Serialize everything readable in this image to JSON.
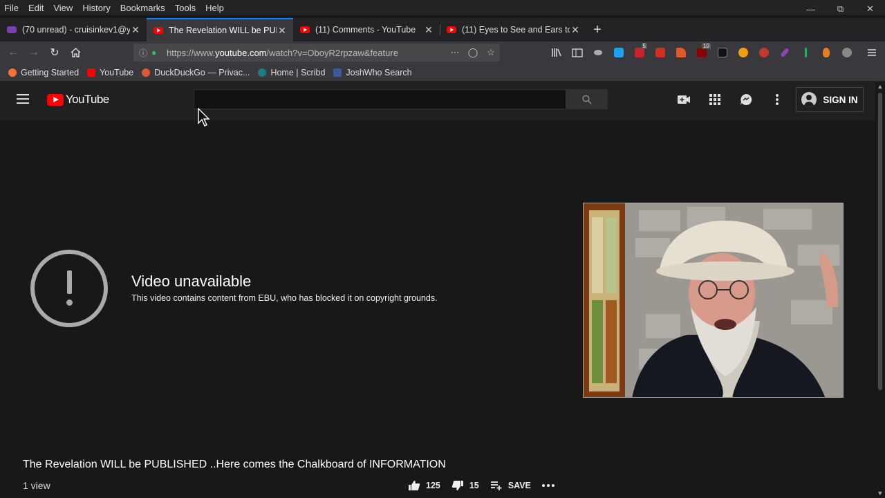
{
  "menubar": {
    "items": [
      "File",
      "Edit",
      "View",
      "History",
      "Bookmarks",
      "Tools",
      "Help"
    ]
  },
  "tabs": [
    {
      "title": "(70 unread) - cruisinkev1@y",
      "active": false
    },
    {
      "title": "The Revelation WILL be PUB",
      "active": true
    },
    {
      "title": "(11) Comments - YouTube",
      "active": false
    },
    {
      "title": "(11) Eyes to See and Ears to",
      "active": false
    }
  ],
  "url": {
    "prefix": "https://www.",
    "domain": "youtube.com",
    "path": "/watch?v=OboyR2rpzaw&feature"
  },
  "bookmarks": [
    "Getting Started",
    "YouTube",
    "DuckDuckGo — Privac...",
    "Home | Scribd",
    "JoshWho Search"
  ],
  "extensions": {
    "abp_badge": "5",
    "ublock_badge": "10"
  },
  "youtube": {
    "logo_text": "YouTube",
    "search_placeholder": "",
    "sign_in": "SIGN IN"
  },
  "player": {
    "error_title": "Video unavailable",
    "error_message": "This video contains content from EBU, who has blocked it on copyright grounds."
  },
  "video": {
    "title": "The Revelation WILL be PUBLISHED ..Here comes the Chalkboard of INFORMATION",
    "views": "1 view",
    "likes": "125",
    "dislikes": "15",
    "save_label": "SAVE"
  }
}
